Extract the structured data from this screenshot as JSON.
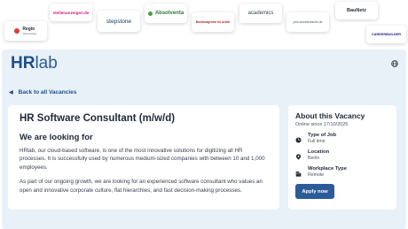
{
  "logos": [
    {
      "name": "Regio",
      "sub": "Jobanzeiger"
    },
    {
      "name": "stellenanzeigen.de",
      "sub": ""
    },
    {
      "name": "stepstone",
      "sub": ""
    },
    {
      "name": "Absolventa",
      "sub": ""
    },
    {
      "name": "Bundesagentur für Arbeit",
      "sub": ""
    },
    {
      "name": "academics",
      "sub": ""
    },
    {
      "name": "jobs.sueddeutsche.de",
      "sub": ""
    },
    {
      "name": "BauNetz",
      "sub": ""
    },
    {
      "name": "CAREERBUILDER",
      "sub": ""
    }
  ],
  "brand": {
    "hr": "HR",
    "lab": "lab"
  },
  "nav": {
    "back_label": "Back to all Vacancies"
  },
  "job": {
    "title": "HR Software Consultant (m/w/d)",
    "section_title": "We are looking for",
    "paragraph_1": "HRlab, our cloud-based software, is one of the most innovative solutions for digitizing all HR processes. It is successfully used by numerous medium-sized companies with between 10 and 1,000 employees.",
    "paragraph_2": "As part of our ongoing growth, we are looking for an experienced software consultant who values an open and innovative corporate culture, flat hierarchies, and fast decision-making processes."
  },
  "vacancy": {
    "title": "About this Vacancy",
    "online_since": "Online since 17/10/2025",
    "type_label": "Type of Job",
    "type_value": "Full time",
    "location_label": "Location",
    "location_value": "Berlin",
    "workplace_label": "Workplace Type",
    "workplace_value": "Remote",
    "apply_label": "Apply now"
  },
  "colors": {
    "brand": "#1e4e8c",
    "button": "#2b5c98",
    "panel": "#e8f0f8"
  }
}
